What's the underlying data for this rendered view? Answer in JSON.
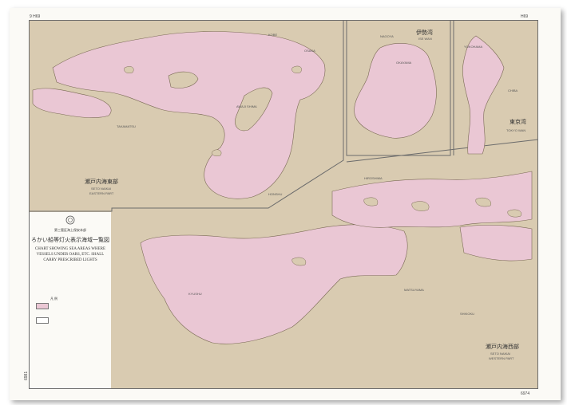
{
  "sheet": {
    "top_left_number": "9 H69",
    "top_right_number": "H69",
    "bottom_left_number": "6981",
    "bottom_right_number": "6974",
    "side_number": "6981"
  },
  "title_block": {
    "authority": "第三管区海上保安本部",
    "title_jp": "ろかい船等灯火表示海域一覧図",
    "title_en_lines": [
      "CHART SHOWING SEA AREAS WHERE",
      "VESSELS UNDER OARS, ETC. SHALL",
      "CARRY PRESCRIBED LIGHTS"
    ],
    "legend_label": "凡 例",
    "legend_items": [
      {
        "color": "#eac7d4"
      },
      {
        "color": "#ffffff"
      }
    ]
  },
  "insets": [
    {
      "name_jp": "瀬戸内海東部",
      "name_en_1": "SETO NAIKAI",
      "name_en_2": "EASTERN PART"
    },
    {
      "name_jp": "伊勢湾",
      "name_en_1": "ISE WAN"
    },
    {
      "name_jp": "東京湾",
      "name_en_1": "TOKYO WAN"
    },
    {
      "name_jp": "瀬戸内海西部",
      "name_en_1": "SETO NAIKAI",
      "name_en_2": "WESTERN PART"
    }
  ],
  "places": {
    "honshu": "HONSHU",
    "shikoku": "SHIKOKU",
    "kyushu": "KYUSHU",
    "awaji": "AWAJI SHIMA",
    "okayama": "OKAYAMA",
    "kobe": "KOBE",
    "osaka": "OSAKA",
    "takamatsu": "TAKAMATSU",
    "hiroshima": "HIROSHIMA",
    "matsuyama": "MATSUYAMA",
    "nagoya": "NAGOYA",
    "yokohama": "YOKOHAMA",
    "chiba": "CHIBA"
  },
  "colors": {
    "land": "#d9cbb1",
    "sea_area": "#eac7d4",
    "outside": "#fbfaf6",
    "coast": "#7a6a55"
  }
}
